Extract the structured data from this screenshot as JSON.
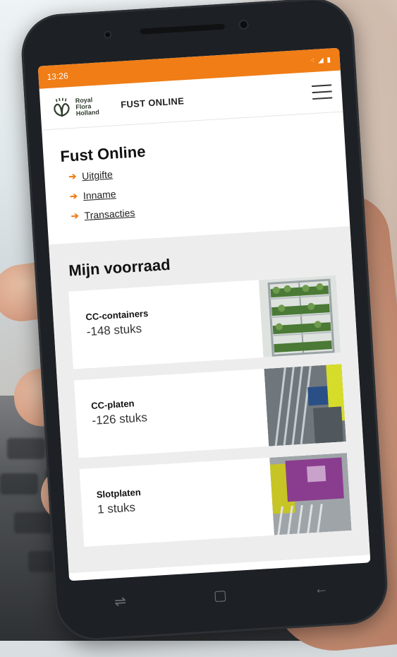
{
  "status": {
    "time": "13:26",
    "indicators": "⁖ ◢ ▮"
  },
  "header": {
    "brand_line1": "Royal",
    "brand_line2": "Flora",
    "brand_line3": "Holland",
    "title": "FUST ONLINE"
  },
  "fust": {
    "heading": "Fust Online",
    "links": [
      {
        "label": "Uitgifte"
      },
      {
        "label": "Inname"
      },
      {
        "label": "Transacties"
      }
    ]
  },
  "inventory": {
    "heading": "Mijn voorraad",
    "items": [
      {
        "name": "CC-containers",
        "count": "-148 stuks"
      },
      {
        "name": "CC-platen",
        "count": "-126 stuks"
      },
      {
        "name": "Slotplaten",
        "count": "1 stuks"
      }
    ]
  },
  "colors": {
    "accent": "#f07d16",
    "brand_green": "#2f3d2d"
  },
  "icons": {
    "menu": "hamburger-icon",
    "link_arrow": "arrow-right-icon",
    "back": "back-icon",
    "home": "home-icon",
    "recents": "recents-icon"
  }
}
